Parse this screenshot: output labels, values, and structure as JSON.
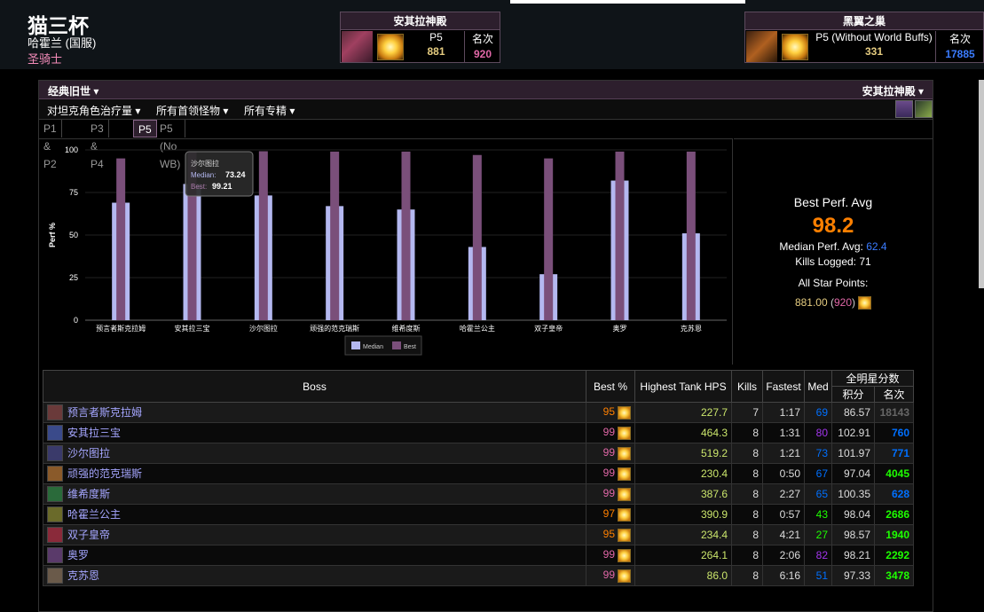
{
  "character": {
    "name": "猫三杯",
    "server": "哈霍兰 (国服)",
    "class": "圣骑士"
  },
  "zone_left": {
    "title": "安其拉神殿",
    "phase": "P5",
    "score": "881",
    "rank_label": "名次",
    "rank": "920"
  },
  "zone_right": {
    "title": "黑翼之巢",
    "phase": "P5 (Without World Buffs)",
    "score": "331",
    "rank_label": "名次",
    "rank": "17885"
  },
  "nav": {
    "expansion": "经典旧世 ▾",
    "zone": "安其拉神殿 ▾",
    "metric": "对坦克角色治疗量 ▾",
    "bosses": "所有首领怪物 ▾",
    "specs": "所有专精 ▾"
  },
  "tabs": [
    "P1 & P2",
    "P3 & P4",
    "P5",
    "P5 (No WB)"
  ],
  "active_tab": "P5",
  "tooltip": {
    "title": "沙尔图拉",
    "median_label": "Median:",
    "median": "73.24",
    "best_label": "Best:",
    "best": "99.21"
  },
  "stats": {
    "best_label": "Best Perf. Avg",
    "best": "98.2",
    "median_label": "Median Perf. Avg:",
    "median": "62.4",
    "kills_label": "Kills Logged:",
    "kills": "71",
    "star_label": "All Star Points:",
    "star_points": "881.00",
    "star_rank": "920"
  },
  "chart_data": {
    "type": "bar",
    "categories": [
      "预言者斯克拉姆",
      "安其拉三宝",
      "沙尔图拉",
      "顽强的范克瑞斯",
      "维希度斯",
      "哈霍兰公主",
      "双子皇帝",
      "奥罗",
      "克苏恩"
    ],
    "series": [
      {
        "name": "Median",
        "values": [
          69,
          80,
          73.24,
          67,
          65,
          43,
          27,
          82,
          51
        ],
        "color": "#b4b8f0"
      },
      {
        "name": "Best",
        "values": [
          95,
          99,
          99.21,
          99,
          99,
          97,
          95,
          99,
          99
        ],
        "color": "#7a4f7a"
      }
    ],
    "ylabel": "Perf %",
    "ylim": [
      0,
      100
    ],
    "yticks": [
      0,
      25,
      50,
      75,
      100
    ],
    "legend": "bottom",
    "grid": true
  },
  "table": {
    "headers": {
      "boss": "Boss",
      "best": "Best %",
      "hps": "Highest Tank HPS",
      "kills": "Kills",
      "fastest": "Fastest",
      "med": "Med",
      "allstar": "全明星分数",
      "points": "积分",
      "rank": "名次"
    },
    "rows": [
      {
        "boss": "预言者斯克拉姆",
        "best": "95",
        "hps": "227.7",
        "kills": "7",
        "fastest": "1:17",
        "med": "69",
        "points": "86.57",
        "rank": "18143",
        "bc": "c-ora",
        "mc": "c-blu",
        "rc": "c-gry",
        "icon": "#6a3a3a"
      },
      {
        "boss": "安其拉三宝",
        "best": "99",
        "hps": "464.3",
        "kills": "8",
        "fastest": "1:31",
        "med": "80",
        "points": "102.91",
        "rank": "760",
        "bc": "c-pnk",
        "mc": "c-pur",
        "rc": "c-blu",
        "icon": "#3a4a8a"
      },
      {
        "boss": "沙尔图拉",
        "best": "99",
        "hps": "519.2",
        "kills": "8",
        "fastest": "1:21",
        "med": "73",
        "points": "101.97",
        "rank": "771",
        "bc": "c-pnk",
        "mc": "c-blu",
        "rc": "c-blu",
        "icon": "#3a3a6a"
      },
      {
        "boss": "顽强的范克瑞斯",
        "best": "99",
        "hps": "230.4",
        "kills": "8",
        "fastest": "0:50",
        "med": "67",
        "points": "97.04",
        "rank": "4045",
        "bc": "c-pnk",
        "mc": "c-blu",
        "rc": "c-grn",
        "icon": "#8a5a2a"
      },
      {
        "boss": "维希度斯",
        "best": "99",
        "hps": "387.6",
        "kills": "8",
        "fastest": "2:27",
        "med": "65",
        "points": "100.35",
        "rank": "628",
        "bc": "c-pnk",
        "mc": "c-blu",
        "rc": "c-blu",
        "icon": "#2a6a3a"
      },
      {
        "boss": "哈霍兰公主",
        "best": "97",
        "hps": "390.9",
        "kills": "8",
        "fastest": "0:57",
        "med": "43",
        "points": "98.04",
        "rank": "2686",
        "bc": "c-ora",
        "mc": "c-grn",
        "rc": "c-grn",
        "icon": "#6a6a2a"
      },
      {
        "boss": "双子皇帝",
        "best": "95",
        "hps": "234.4",
        "kills": "8",
        "fastest": "4:21",
        "med": "27",
        "points": "98.57",
        "rank": "1940",
        "bc": "c-ora",
        "mc": "c-grn",
        "rc": "c-grn",
        "icon": "#8a2a3a"
      },
      {
        "boss": "奥罗",
        "best": "99",
        "hps": "264.1",
        "kills": "8",
        "fastest": "2:06",
        "med": "82",
        "points": "98.21",
        "rank": "2292",
        "bc": "c-pnk",
        "mc": "c-pur",
        "rc": "c-grn",
        "icon": "#5a3a6a"
      },
      {
        "boss": "克苏恩",
        "best": "99",
        "hps": "86.0",
        "kills": "8",
        "fastest": "6:16",
        "med": "51",
        "points": "97.33",
        "rank": "3478",
        "bc": "c-pnk",
        "mc": "c-blu",
        "rc": "c-grn",
        "icon": "#6a5a4a"
      }
    ]
  }
}
